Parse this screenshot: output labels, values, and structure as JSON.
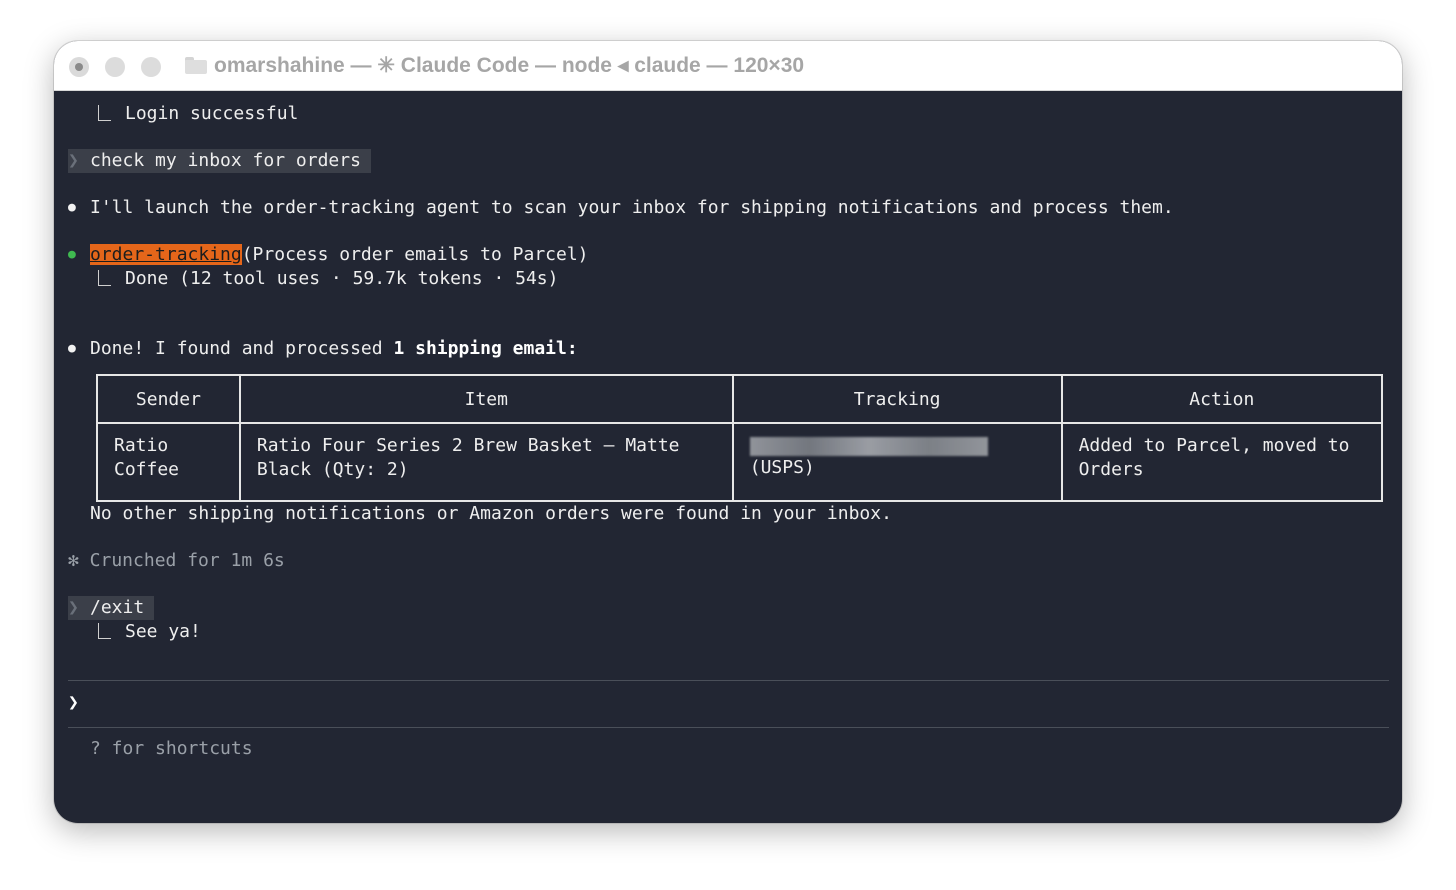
{
  "window": {
    "title": "omarshahine — ✳ Claude Code — node ◂ claude — 120×30"
  },
  "terminal": {
    "login_result": "Login successful",
    "prompt_1": "check my inbox for orders",
    "assistant_msg_1": "I'll launch the order-tracking agent to scan your inbox for shipping notifications and process them.",
    "agent_name": "order-tracking",
    "agent_args": "(Process order emails to Parcel)",
    "agent_result": "Done (12 tool uses · 59.7k tokens · 54s)",
    "assistant_msg_2_prefix": "Done! I found and processed ",
    "assistant_msg_2_bold": "1 shipping email:",
    "table": {
      "headers": [
        "Sender",
        "Item",
        "Tracking",
        "Action"
      ],
      "rows": [
        {
          "sender_line1": "Ratio",
          "sender_line2": "Coffee",
          "item_line1": "Ratio Four Series 2 Brew Basket – Matte",
          "item_line2": "Black (Qty: 2)",
          "tracking_carrier": "(USPS)",
          "action_line1": "Added to Parcel, moved to",
          "action_line2": "Orders"
        }
      ]
    },
    "after_table": "No other shipping notifications or Amazon orders were found in your inbox.",
    "status": "✻ Crunched for 1m 6s",
    "prompt_2": "/exit",
    "exit_result": "See ya!",
    "input_prompt": "❯",
    "hint": "? for shortcuts"
  },
  "colors": {
    "terminal_bg": "#222633",
    "agent_highlight": "#e5661a",
    "agent_dot": "#3fb950"
  }
}
